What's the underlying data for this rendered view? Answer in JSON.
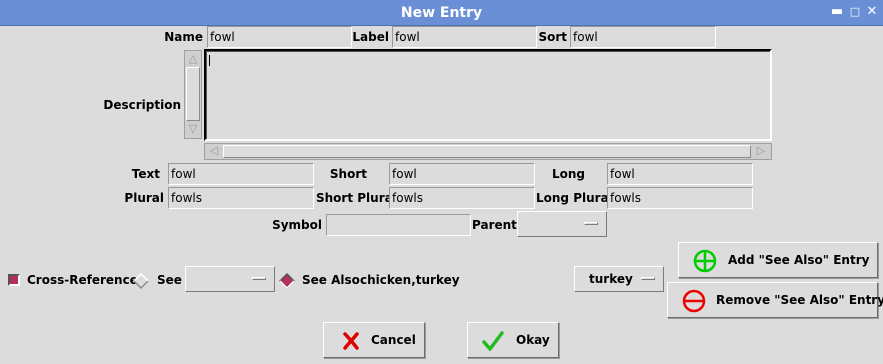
{
  "window": {
    "title": "New Entry"
  },
  "name": {
    "label": "Name",
    "value": "fowl"
  },
  "label_field": {
    "label": "Label",
    "value": "fowl"
  },
  "sort": {
    "label": "Sort",
    "value": "fowl"
  },
  "description": {
    "label": "Description",
    "value": ""
  },
  "text": {
    "label": "Text",
    "value": "fowl"
  },
  "short": {
    "label": "Short",
    "value": "fowl"
  },
  "long": {
    "label": "Long",
    "value": "fowl"
  },
  "plural": {
    "label": "Plural",
    "value": "fowls"
  },
  "short_plural": {
    "label": "Short Plural",
    "value": "fowls"
  },
  "long_plural": {
    "label": "Long Plural",
    "value": "fowls"
  },
  "symbol": {
    "label": "Symbol",
    "value": ""
  },
  "parent": {
    "label": "Parent",
    "value": ""
  },
  "crossref": {
    "checkbox_label": "Cross-Reference",
    "checked": true,
    "see_label": "See",
    "see_value": "",
    "see_also_label": "See Also",
    "see_also_value": "chicken,turkey",
    "see_also_selected": true,
    "entry_menu_value": "turkey",
    "add_button": "Add \"See Also\" Entry",
    "remove_button": "Remove \"See Also\" Entry"
  },
  "buttons": {
    "cancel": "Cancel",
    "okay": "Okay"
  },
  "colors": {
    "titlebar": "#6a8fd6",
    "add_icon": "#00cc00",
    "remove_icon": "#ee0000",
    "cancel_icon": "#e00000",
    "okay_icon": "#22bb22"
  }
}
